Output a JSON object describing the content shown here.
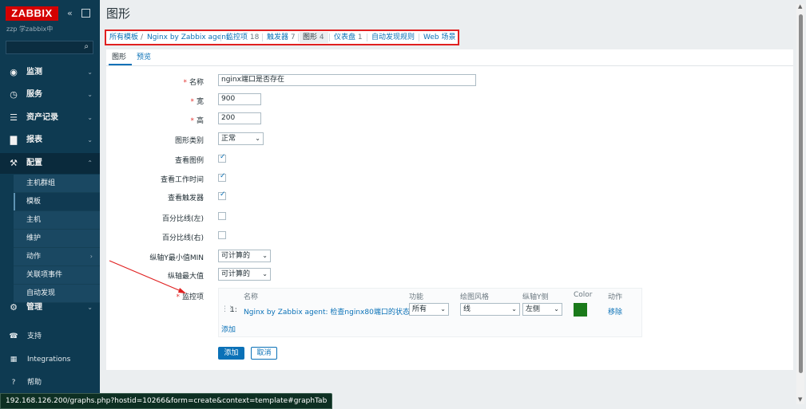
{
  "sidebar": {
    "logo": "ZABBIX",
    "server_name": "zzp 学zabbix中",
    "menu": {
      "monitoring": "监测",
      "services": "服务",
      "inventory": "资产记录",
      "reports": "报表",
      "configuration": "配置",
      "administration": "管理"
    },
    "config_sub": [
      "主机群组",
      "模板",
      "主机",
      "维护",
      "动作",
      "关联项事件",
      "自动发现"
    ],
    "bottom": {
      "support": "支持",
      "integrations": "Integrations",
      "help": "帮助"
    }
  },
  "status_url": "192.168.126.200/graphs.php?hostid=10266&form=create&context=template#graphTab",
  "page": {
    "title": "图形"
  },
  "breadcrumb": {
    "all_templates": "所有模板",
    "separator": "/",
    "template": "Nginx by Zabbix agent",
    "items_label": "监控项",
    "items_count": "18",
    "triggers_label": "触发器",
    "triggers_count": "7",
    "graphs_label": "图形",
    "graphs_count": "4",
    "dashboards_label": "仪表盘",
    "dashboards_count": "1",
    "discovery": "自动发现规则",
    "web": "Web 场景"
  },
  "tabs": {
    "graph": "图形",
    "preview": "预览"
  },
  "form": {
    "name_label": "名称",
    "name_value": "nginx端口是否存在",
    "width_label": "宽",
    "width_value": "900",
    "height_label": "高",
    "height_value": "200",
    "graph_type_label": "图形类别",
    "graph_type_value": "正常",
    "show_legend_label": "查看图例",
    "show_work_period_label": "查看工作时间",
    "show_triggers_label": "查看触发器",
    "percentile_left_label": "百分比线(左)",
    "percentile_right_label": "百分比线(右)",
    "ymin_label": "纵轴Y最小值MIN",
    "ymin_value": "可计算的",
    "ymax_label": "纵轴最大值",
    "ymax_value": "可计算的",
    "items_label": "监控项",
    "items_header": {
      "name": "名称",
      "function": "功能",
      "draw_style": "绘图风格",
      "y_axis": "纵轴Y侧",
      "color": "Color",
      "action": "动作"
    },
    "item_row": {
      "index": "1:",
      "name": "Nginx by Zabbix agent: 检查nginx80端口的状态",
      "function": "所有",
      "draw_style": "线",
      "y_axis": "左侧",
      "color": "#1a7a1a",
      "remove": "移除"
    },
    "add_item_link": "添加",
    "add_button": "添加",
    "cancel_button": "取消"
  }
}
